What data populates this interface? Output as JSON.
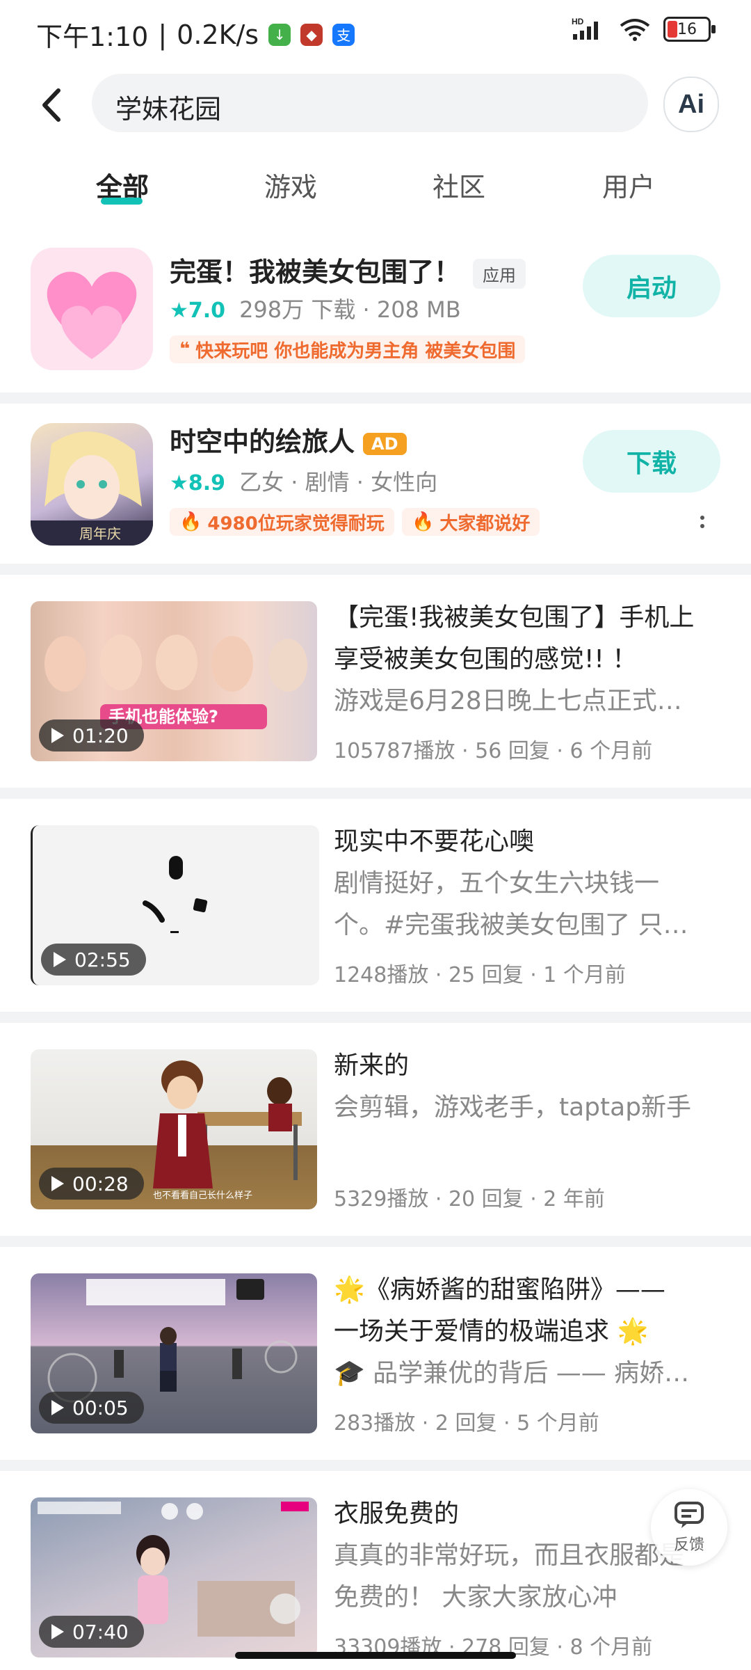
{
  "status_bar": {
    "time": "下午1:10",
    "speed": "0.2K/s",
    "network": "HD",
    "battery": "16"
  },
  "search": {
    "query": "学妹花园"
  },
  "ai_button": {
    "label": "Ai"
  },
  "tabs": [
    {
      "label": "全部",
      "active": true
    },
    {
      "label": "游戏"
    },
    {
      "label": "社区"
    },
    {
      "label": "用户"
    }
  ],
  "apps": [
    {
      "title": "完蛋！我被美女包围了！",
      "badge": "应用",
      "rating": "7.0",
      "meta": "298万 下载 · 208 MB",
      "tags": [
        "快来玩吧 你也能成为男主角 被美女包围"
      ],
      "action": "启动",
      "icon": "heart-icon"
    },
    {
      "title": "时空中的绘旅人",
      "badge": "AD",
      "rating": "8.9",
      "meta": "乙女 · 剧情 · 女性向",
      "tags": [
        "4980位玩家觉得耐玩",
        "大家都说好"
      ],
      "action": "下载",
      "icon_text": "周年庆"
    }
  ],
  "posts": [
    {
      "duration": "01:20",
      "title_lines": [
        "【完蛋!我被美女包围了】手机上",
        "享受被美女包围的感觉!! ！"
      ],
      "sub_lines": [
        "游戏是6月28日晚上七点正式…"
      ],
      "meta": "105787播放 · 56 回复 · 6 个月前",
      "thumb_text": "手机也能体验?"
    },
    {
      "duration": "02:55",
      "title_lines": [
        "现实中不要花心噢"
      ],
      "sub_lines": [
        "剧情挺好，五个女生六块钱一",
        "个。#完蛋我被美女包围了 只…"
      ],
      "meta": "1248播放 · 25 回复 · 1 个月前"
    },
    {
      "duration": "00:28",
      "title_lines": [
        "新来的"
      ],
      "sub_lines": [
        "会剪辑，游戏老手，taptap新手"
      ],
      "meta": "5329播放 · 20 回复 · 2 年前",
      "thumb_caption": "也不看看自己长什么样子"
    },
    {
      "duration": "00:05",
      "title_lines": [
        "🌟《病娇酱的甜蜜陷阱》——",
        "一场关于爱情的极端追求 🌟"
      ],
      "sub_lines": [
        "🎓 品学兼优的背后 —— 病娇…"
      ],
      "meta": "283播放 · 2 回复 · 5 个月前"
    },
    {
      "duration": "07:40",
      "title_lines": [
        "衣服免费的"
      ],
      "sub_lines": [
        "真真的非常好玩，而且衣服都是",
        "免费的！ 大家大家放心冲"
      ],
      "meta": "33309播放 · 278 回复 · 8 个月前"
    }
  ],
  "feedback": {
    "label": "反馈"
  },
  "colors": {
    "accent": "#12c2b6",
    "tag_orange": "#ef6a2f",
    "ad_orange": "#f5a021"
  }
}
